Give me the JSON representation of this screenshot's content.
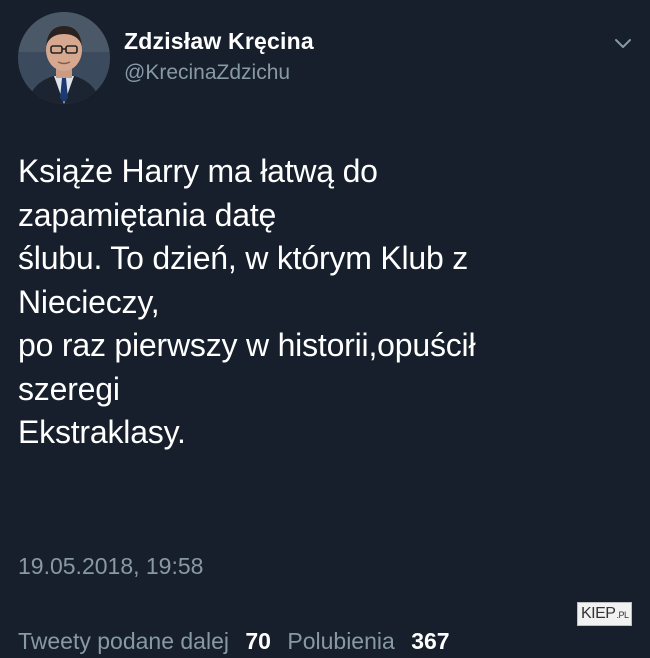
{
  "author": {
    "name": "Zdzisław Kręcina",
    "handle": "@KrecinaZdzichu"
  },
  "tweet": {
    "lines": [
      "Książe Harry ma łatwą do",
      "zapamiętania datę",
      "ślubu. To dzień, w którym Klub z",
      "Niecieczy,",
      "po raz pierwszy w historii,opuścił",
      "szeregi",
      "Ekstraklasy."
    ],
    "timestamp": "19.05.2018, 19:58"
  },
  "stats": {
    "retweets_label": "Tweety podane dalej",
    "retweets_count": "70",
    "likes_label": "Polubienia",
    "likes_count": "367"
  },
  "watermark": {
    "text": "KIEP",
    "suffix": ".PL"
  },
  "icons": {
    "menu": "chevron-down-icon",
    "avatar": "avatar"
  }
}
